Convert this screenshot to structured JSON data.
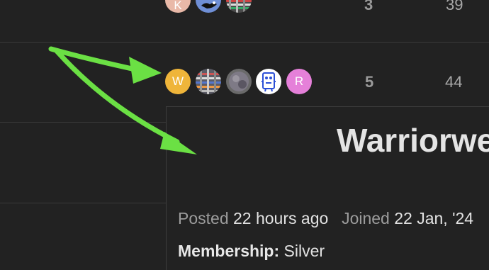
{
  "topics": [
    {
      "avatars": [
        {
          "type": "letter",
          "letter": "K",
          "color": "#e9b9a8",
          "icon": "user-avatar-k"
        },
        {
          "type": "image",
          "color": "#6f8fd6",
          "icon": "user-avatar-bird-image"
        },
        {
          "type": "image",
          "color": "#4a4a4a",
          "icon": "user-avatar-pattern-image"
        }
      ],
      "replies": "3",
      "views": "39"
    },
    {
      "avatars": [
        {
          "type": "letter",
          "letter": "W",
          "color": "#efb53a",
          "icon": "user-avatar-w"
        },
        {
          "type": "image",
          "color": "#5c5c66",
          "icon": "user-avatar-pattern-image"
        },
        {
          "type": "image",
          "color": "#6a6a6a",
          "icon": "user-avatar-photo-image"
        },
        {
          "type": "image",
          "color": "#ffffff",
          "icon": "user-avatar-robot-image"
        },
        {
          "type": "letter",
          "letter": "R",
          "color": "#e580d9",
          "icon": "user-avatar-r"
        }
      ],
      "replies": "5",
      "views": "44"
    }
  ],
  "user_card": {
    "name": "Warriorwe",
    "posted_label": "Posted",
    "posted_value": "22 hours ago",
    "joined_label": "Joined",
    "joined_value": "22 Jan, '24",
    "membership_label": "Membership:",
    "membership_value": "Silver"
  },
  "annotation": {
    "arrow_color": "#6be044"
  }
}
